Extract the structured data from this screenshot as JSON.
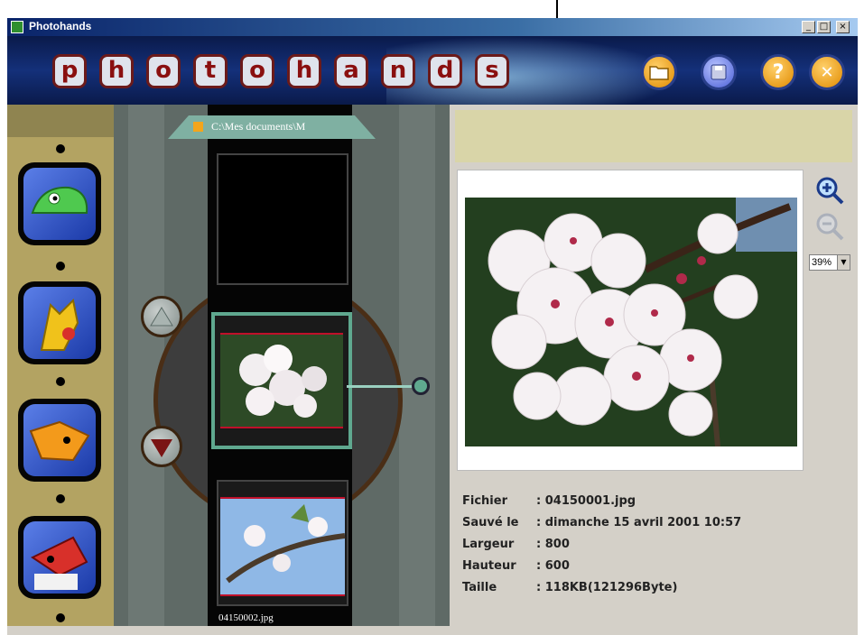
{
  "window": {
    "title": "Photohands",
    "controls": [
      "_",
      "□",
      "×"
    ]
  },
  "banner": {
    "logo_letters": [
      "p",
      "h",
      "o",
      "t",
      "o",
      "h",
      "a",
      "n",
      "d",
      "s"
    ],
    "toolbar": [
      {
        "name": "open-folder",
        "color": "#f3a51b",
        "glyph": "📂"
      },
      {
        "name": "save",
        "color": "#6b7ee8",
        "glyph": "💾"
      },
      {
        "name": "help",
        "color": "#f3a51b",
        "glyph": "?"
      },
      {
        "name": "close",
        "color": "#f3a51b",
        "glyph": "✕"
      }
    ]
  },
  "tools": [
    {
      "name": "chameleon-icon"
    },
    {
      "name": "kangaroo-icon"
    },
    {
      "name": "fox-icon"
    },
    {
      "name": "bird-icon"
    }
  ],
  "film": {
    "folder_path": "C:\\Mes documents\\M",
    "frames": [
      {
        "state": "empty"
      },
      {
        "state": "selected",
        "caption": ""
      },
      {
        "state": "normal",
        "caption": "04150002.jpg"
      }
    ],
    "up_arrow": "▲",
    "down_arrow": "▼"
  },
  "preview": {
    "zoom_in": "+",
    "zoom_out": "−",
    "zoom_level": "39%"
  },
  "info": {
    "labels": [
      "Fichier",
      "Sauvé le",
      "Largeur",
      "Hauteur",
      "Taille"
    ],
    "values": [
      ": 04150001.jpg",
      ": dimanche 15 avril 2001 10:57",
      ": 800",
      ": 600",
      ": 118KB(121296Byte)"
    ]
  },
  "colors": {
    "banner": "#14307a",
    "toolstrip": "#b3a362",
    "film_selected_border": "#5fa88f",
    "accent_red": "#c0102a"
  }
}
